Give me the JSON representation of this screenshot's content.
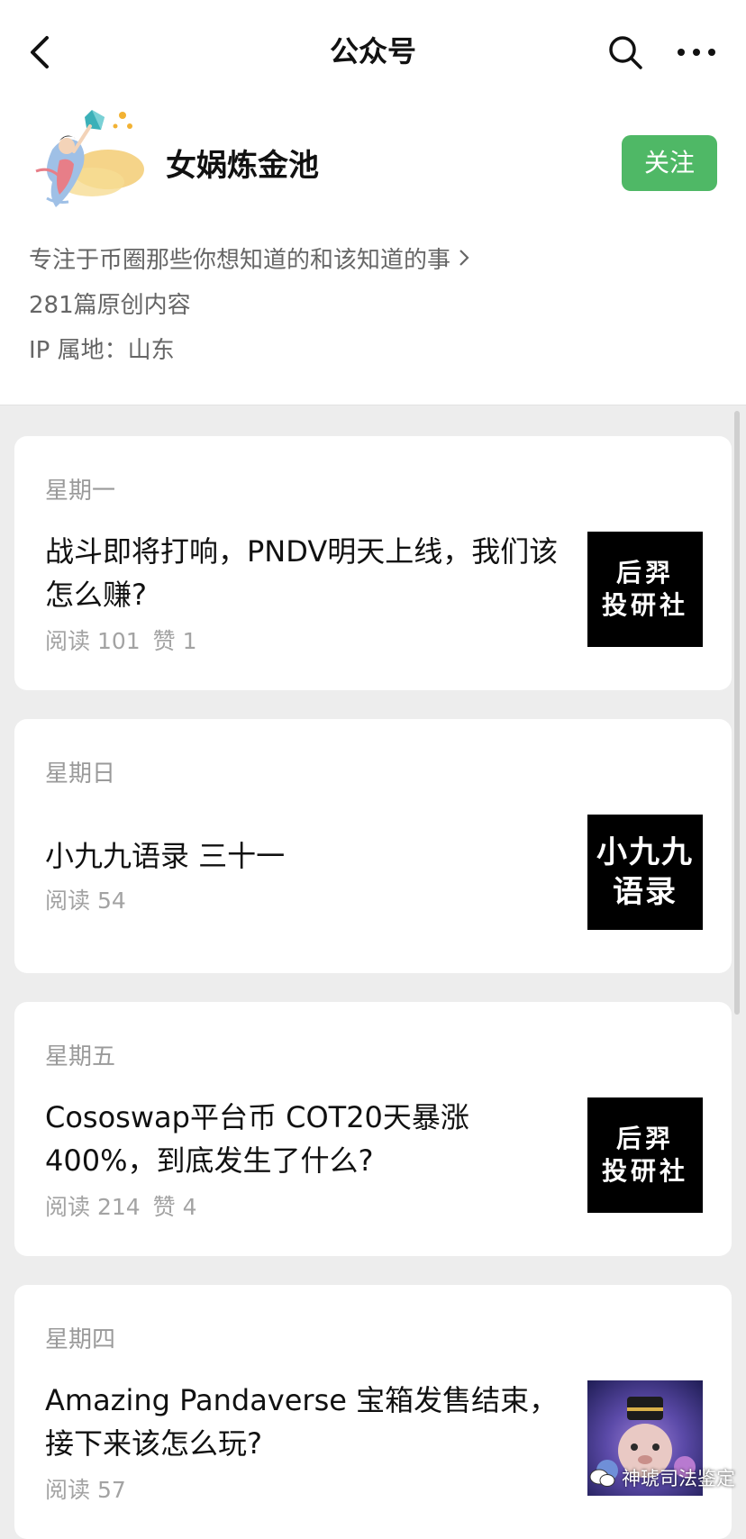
{
  "nav": {
    "title": "公众号"
  },
  "account": {
    "name": "女娲炼金池",
    "follow_label": "关注",
    "description": "专注于币圈那些你想知道的和该知道的事",
    "original_count": "281篇原创内容",
    "ip_location": "IP 属地：山东"
  },
  "articles": [
    {
      "day": "星期一",
      "title": "战斗即将打响，PNDV明天上线，我们该怎么赚?",
      "reads": "阅读 101",
      "likes": "赞 1",
      "thumb": [
        "后羿",
        "投研社"
      ]
    },
    {
      "day": "星期日",
      "title": "小九九语录  三十一",
      "reads": "阅读 54",
      "likes": "",
      "thumb": [
        "小九九",
        "语录"
      ]
    },
    {
      "day": "星期五",
      "title": "Cososwap平台币 COT20天暴涨400%，到底发生了什么?",
      "reads": "阅读 214",
      "likes": "赞 4",
      "thumb": [
        "后羿",
        "投研社"
      ]
    },
    {
      "day": "星期四",
      "title": "Amazing Pandaverse 宝箱发售结束，接下来该怎么玩?",
      "reads": "阅读 57",
      "likes": "",
      "thumb": []
    }
  ],
  "watermark": "神琥司法鉴定",
  "colors": {
    "follow_button": "#4fb866",
    "page_background": "#ededed",
    "card_background": "#ffffff"
  }
}
